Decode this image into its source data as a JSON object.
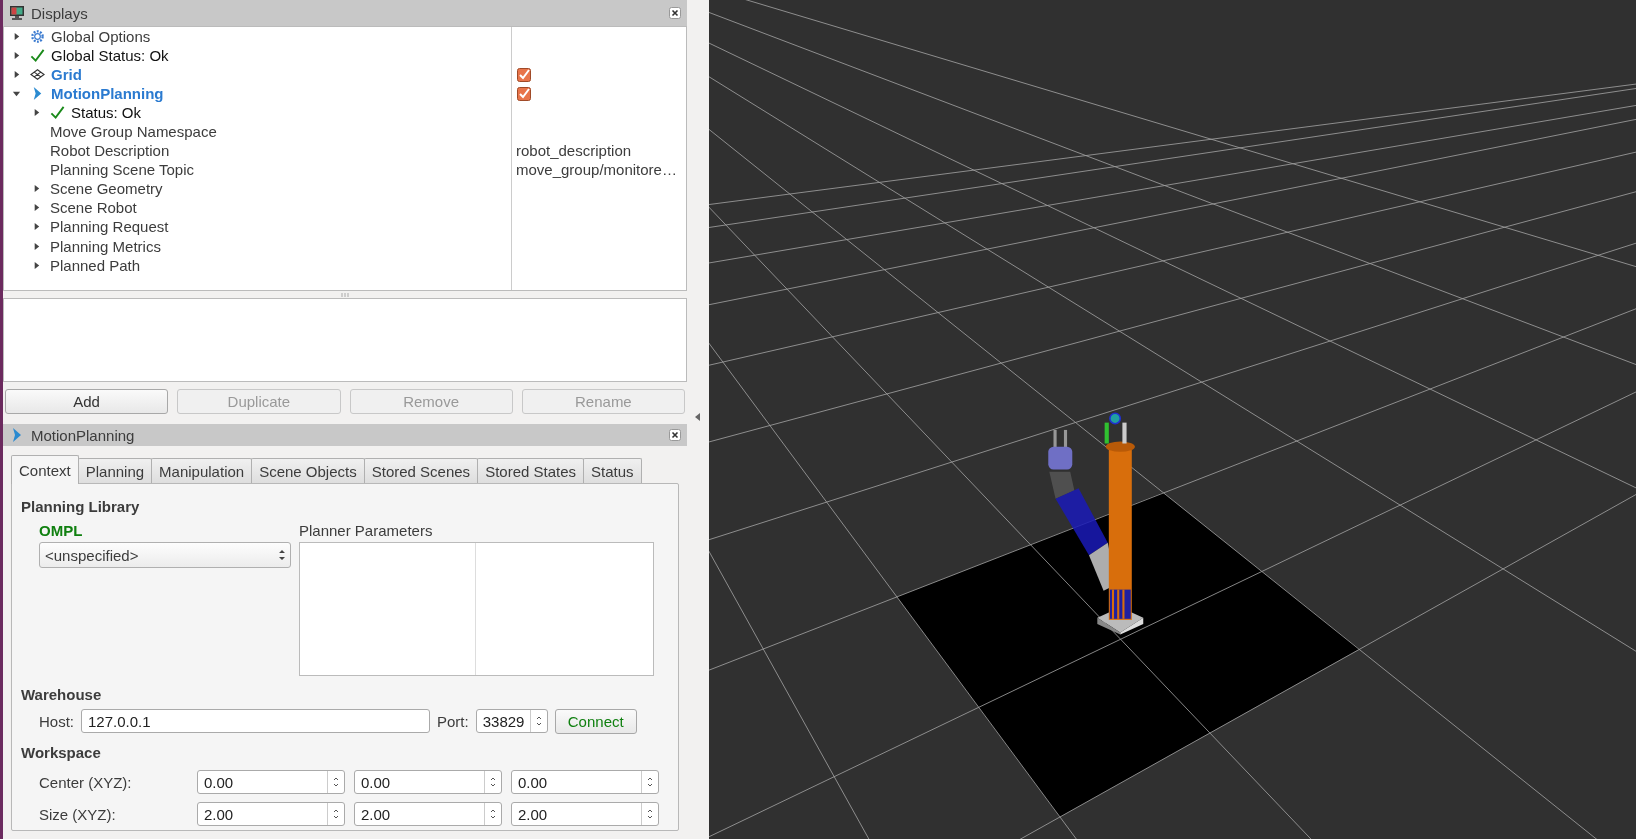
{
  "displays_panel": {
    "title": "Displays",
    "tree": [
      {
        "label": "Global Options",
        "kind": "options",
        "expanded": false
      },
      {
        "label": "Global Status: Ok",
        "kind": "status",
        "expanded": false
      },
      {
        "label": "Grid",
        "kind": "grid",
        "expanded": false,
        "checked": true
      },
      {
        "label": "MotionPlanning",
        "kind": "planning",
        "expanded": true,
        "checked": true,
        "children": [
          {
            "label": "Status: Ok",
            "kind": "status",
            "expanded": false
          },
          {
            "label": "Move Group Namespace",
            "kind": "property"
          },
          {
            "label": "Robot Description",
            "kind": "property",
            "value": "robot_description"
          },
          {
            "label": "Planning Scene Topic",
            "kind": "property",
            "value": "move_group/monitore…"
          },
          {
            "label": "Scene Geometry",
            "kind": "group",
            "expanded": false
          },
          {
            "label": "Scene Robot",
            "kind": "group",
            "expanded": false
          },
          {
            "label": "Planning Request",
            "kind": "group",
            "expanded": false
          },
          {
            "label": "Planning Metrics",
            "kind": "group",
            "expanded": false
          },
          {
            "label": "Planned Path",
            "kind": "group",
            "expanded": false
          }
        ]
      }
    ],
    "buttons": [
      {
        "label": "Add",
        "disabled": false
      },
      {
        "label": "Duplicate",
        "disabled": true
      },
      {
        "label": "Remove",
        "disabled": true
      },
      {
        "label": "Rename",
        "disabled": true
      }
    ]
  },
  "motion_planning_panel": {
    "title": "MotionPlanning",
    "tabs": [
      {
        "label": "Context",
        "selected": true
      },
      {
        "label": "Planning",
        "selected": false
      },
      {
        "label": "Manipulation",
        "selected": false
      },
      {
        "label": "Scene Objects",
        "selected": false
      },
      {
        "label": "Stored Scenes",
        "selected": false
      },
      {
        "label": "Stored States",
        "selected": false
      },
      {
        "label": "Status",
        "selected": false
      }
    ],
    "planning_library": {
      "heading": "Planning Library",
      "library": "OMPL",
      "planner": "<unspecified>",
      "parameters_label": "Planner Parameters"
    },
    "warehouse": {
      "heading": "Warehouse",
      "host_label": "Host:",
      "host": "127.0.0.1",
      "port_label": "Port:",
      "port": "33829",
      "connect": "Connect"
    },
    "workspace": {
      "heading": "Workspace",
      "rows": [
        {
          "label": "Center (XYZ):",
          "values": [
            "0.00",
            "0.00",
            "0.00"
          ]
        },
        {
          "label": "Size (XYZ):",
          "values": [
            "2.00",
            "2.00",
            "2.00"
          ]
        }
      ]
    }
  }
}
